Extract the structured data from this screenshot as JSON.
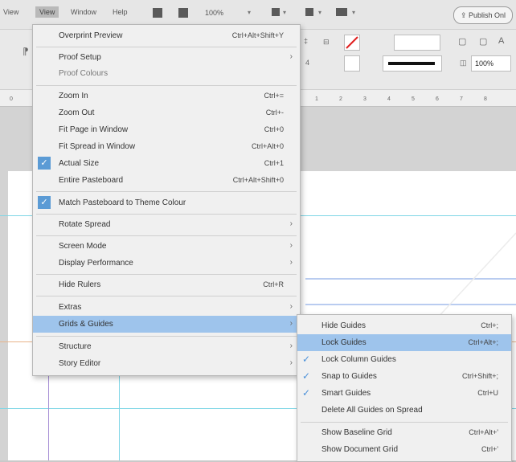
{
  "menubar": {
    "left_items": [
      "View",
      "View",
      "Window",
      "Help"
    ],
    "zoom": "100%",
    "publish_label": "Publish Onl",
    "publish_icon": "share-icon"
  },
  "control_panel": {
    "pct_value": "100%",
    "angle_label": "4",
    "ruler_ticks": [
      "0",
      "1",
      "2",
      "3",
      "4",
      "5",
      "6",
      "7",
      "8"
    ]
  },
  "view_menu": {
    "items": [
      {
        "label": "Overprint Preview",
        "shortcut": "Ctrl+Alt+Shift+Y"
      },
      {
        "label": "Proof Setup",
        "submenu": true
      },
      {
        "label": "Proof Colours",
        "dim": true
      },
      {
        "label": "Zoom In",
        "shortcut": "Ctrl+="
      },
      {
        "label": "Zoom Out",
        "shortcut": "Ctrl+-"
      },
      {
        "label": "Fit Page in Window",
        "shortcut": "Ctrl+0"
      },
      {
        "label": "Fit Spread in Window",
        "shortcut": "Ctrl+Alt+0"
      },
      {
        "label": "Actual Size",
        "shortcut": "Ctrl+1",
        "checked": true
      },
      {
        "label": "Entire Pasteboard",
        "shortcut": "Ctrl+Alt+Shift+0"
      },
      {
        "label": "Match Pasteboard to Theme Colour",
        "checked": true
      },
      {
        "label": "Rotate Spread",
        "submenu": true
      },
      {
        "label": "Screen Mode",
        "submenu": true
      },
      {
        "label": "Display Performance",
        "submenu": true
      },
      {
        "label": "Hide Rulers",
        "shortcut": "Ctrl+R"
      },
      {
        "label": "Extras",
        "submenu": true
      },
      {
        "label": "Grids & Guides",
        "submenu": true,
        "highlighted": true
      },
      {
        "label": "Structure",
        "submenu": true
      },
      {
        "label": "Story Editor",
        "submenu": true
      }
    ]
  },
  "grids_submenu": {
    "items": [
      {
        "label": "Hide Guides",
        "shortcut": "Ctrl+;"
      },
      {
        "label": "Lock Guides",
        "shortcut": "Ctrl+Alt+;",
        "highlighted": true
      },
      {
        "label": "Lock Column Guides",
        "checked": true
      },
      {
        "label": "Snap to Guides",
        "shortcut": "Ctrl+Shift+;",
        "checked": true
      },
      {
        "label": "Smart Guides",
        "shortcut": "Ctrl+U",
        "checked": true
      },
      {
        "label": "Delete All Guides on Spread"
      },
      {
        "label": "Show Baseline Grid",
        "shortcut": "Ctrl+Alt+'"
      },
      {
        "label": "Show Document Grid",
        "shortcut": "Ctrl+'"
      }
    ]
  },
  "colors": {
    "highlight": "#9ec4ec",
    "check": "#5b9bd5",
    "guide_cyan": "#7fd6e6",
    "guide_purple": "#a78fd6"
  }
}
